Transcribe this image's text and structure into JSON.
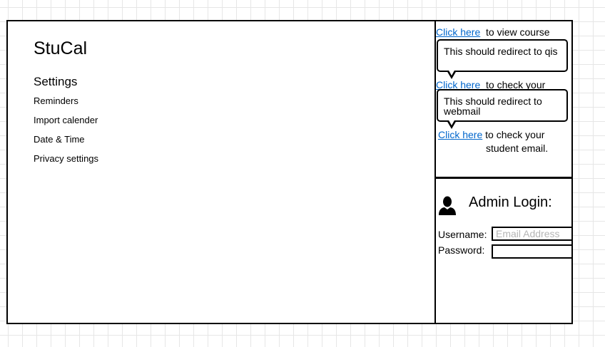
{
  "app": {
    "title": "StuCal"
  },
  "settings": {
    "heading": "Settings",
    "items": [
      "Reminders",
      "Import calender",
      "Date & Time",
      "Privacy settings"
    ]
  },
  "links": [
    {
      "link_text": "Click here",
      "rest": "to view course"
    },
    {
      "link_text": "Click here",
      "rest": "to check your"
    },
    {
      "link_text": "Click here",
      "rest_line1": "to check your",
      "rest_line2": "student email."
    }
  ],
  "callouts": [
    {
      "text": "This should redirect to qis"
    },
    {
      "text": "This should redirect to webmail"
    }
  ],
  "admin": {
    "title": "Admin Login:",
    "username_label": "Username:",
    "username_placeholder": "Email Address",
    "password_label": "Password:"
  }
}
